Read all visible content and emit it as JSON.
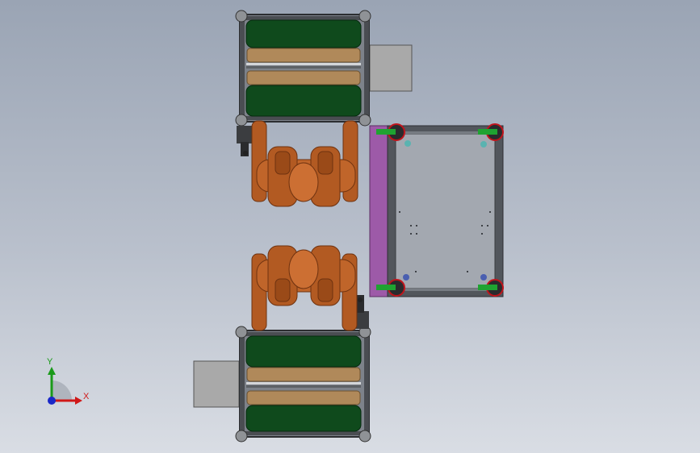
{
  "viewport": {
    "background_top": "#9aa4b4",
    "background_bottom": "#d9dde4"
  },
  "colors": {
    "frame": "#3c3f44",
    "frame_light": "#8a8f96",
    "belt": "#0f4a1c",
    "plank": "#b0895a",
    "robot": "#b25a22",
    "robot_dark": "#6e3210",
    "motor_box": "#a9a9a9",
    "table_top": "#a3a8b0",
    "table_frame": "#52565c",
    "side_panel": "#9d5aa8",
    "caster_red": "#c0141c",
    "caster_green": "#1fa331"
  },
  "triad": {
    "x_label": "X",
    "y_label": "Y",
    "x_color": "#d01818",
    "y_color": "#1a9a1a",
    "z_color": "#1a28c8"
  }
}
